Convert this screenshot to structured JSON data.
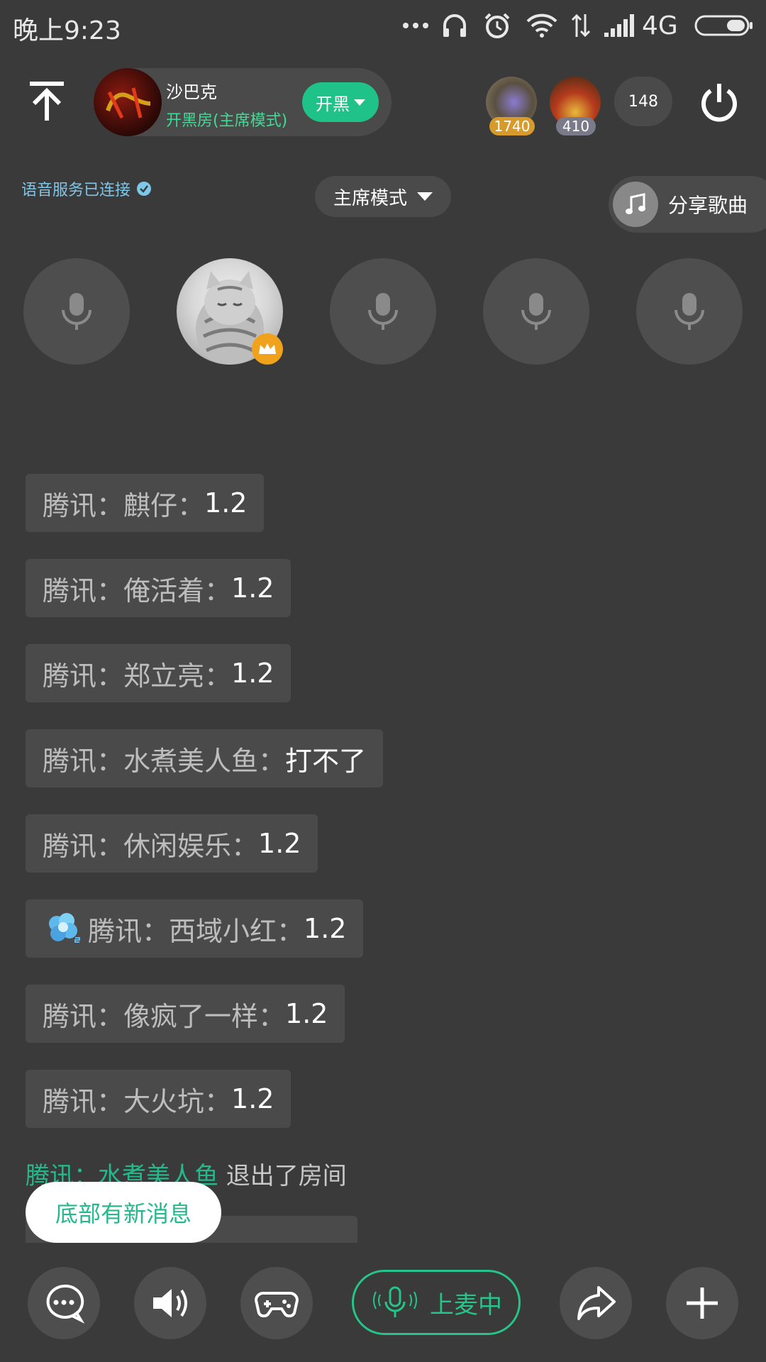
{
  "status_bar": {
    "time": "晚上9:23",
    "network": "4G",
    "icons": [
      "more-dots-icon",
      "headphones-icon",
      "alarm-icon",
      "wifi-icon",
      "data-arrows-icon",
      "signal-icon",
      "battery-icon"
    ]
  },
  "header": {
    "room_name": "沙巴克",
    "room_subtitle": "开黑房(主席模式)",
    "mode_button_label": "开黑",
    "rank_badges": [
      "1740",
      "410"
    ],
    "online_count": "148"
  },
  "voice_status": "语音服务已连接",
  "chair_mode_label": "主席模式",
  "share_song_label": "分享歌曲",
  "messages": [
    {
      "prefix": "腾讯：麒仔：",
      "text": "1.2"
    },
    {
      "prefix": "腾讯：俺活着：",
      "text": "1.2"
    },
    {
      "prefix": "腾讯：郑立亮：",
      "text": "1.2"
    },
    {
      "prefix": "腾讯：水煮美人鱼：",
      "text": "打不了"
    },
    {
      "prefix": "腾讯：休闲娱乐：",
      "text": "1.2"
    },
    {
      "prefix": "腾讯：西域小红：",
      "text": "1.2"
    },
    {
      "prefix": "腾讯：像疯了一样：",
      "text": "1.2"
    },
    {
      "prefix": "腾讯：大火坑：",
      "text": "1.2"
    }
  ],
  "system_notice": {
    "who": "腾讯：水煮美人鱼",
    "action": " 退出了房间"
  },
  "new_message_banner": "底部有新消息",
  "bottom_bar": {
    "mic_status_label": "上麦中"
  },
  "colors": {
    "background": "#3a3a3a",
    "accent_green": "#25c48a",
    "voice_status_blue": "#7cc7ea",
    "crown_orange": "#f0a21c"
  }
}
